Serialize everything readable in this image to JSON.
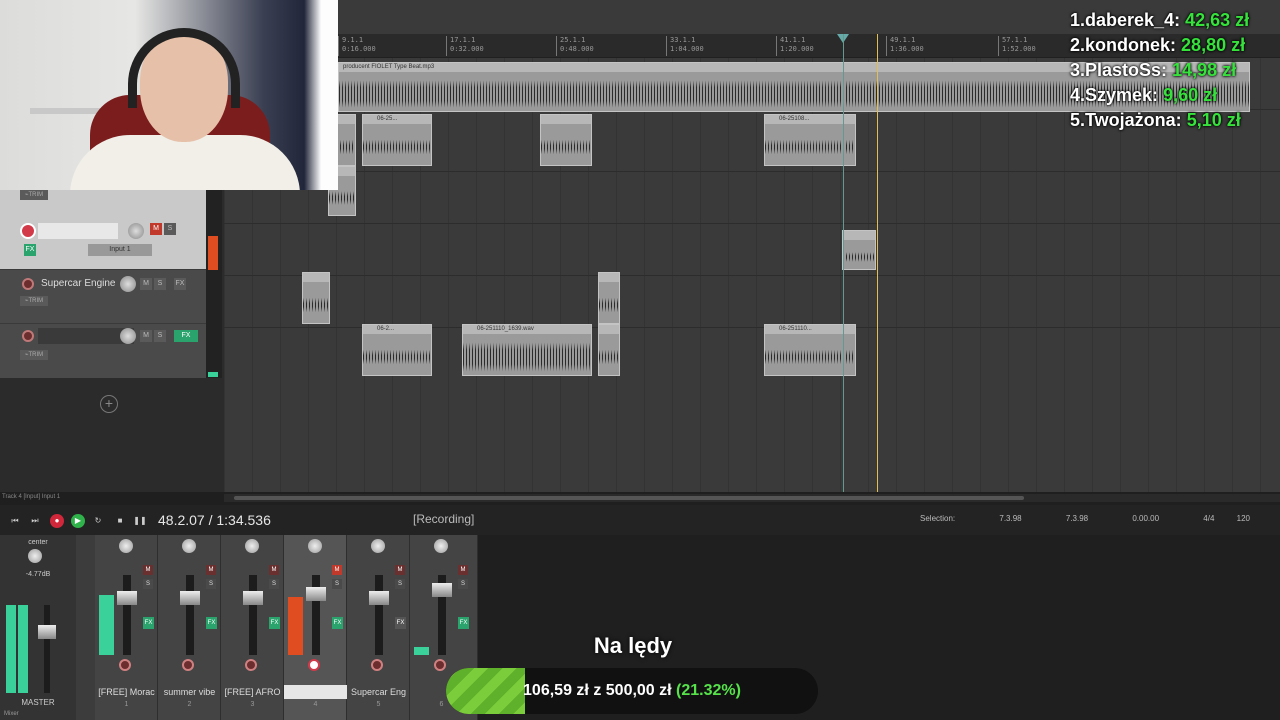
{
  "timeline": {
    "ticks": [
      {
        "label": "9.1.1",
        "sub": "0:16.000"
      },
      {
        "label": "17.1.1",
        "sub": "0:32.000"
      },
      {
        "label": "25.1.1",
        "sub": "0:48.000"
      },
      {
        "label": "33.1.1",
        "sub": "1:04.000"
      },
      {
        "label": "41.1.1",
        "sub": "1:20.000"
      },
      {
        "label": "49.1.1",
        "sub": "1:36.000"
      },
      {
        "label": "57.1.1",
        "sub": "1:52.000"
      }
    ]
  },
  "items": {
    "beat_name": "producent FIOLET Type Beat.mp3",
    "clip_a": "06-25...",
    "clip_b": "06-25108...",
    "clip_c": "06-2...",
    "clip_d": "06-251110_1639.wav",
    "clip_e": "06-251110..."
  },
  "tracks": [
    {
      "name": "",
      "input": "Input 1",
      "selected": true
    },
    {
      "name": "Supercar Engine F",
      "selected": false
    },
    {
      "name": "",
      "selected": false
    }
  ],
  "tcp_status": "Track 4 [Input] Input 1",
  "transport": {
    "position": "48.2.07 / 1:34.536",
    "state": "[Recording]",
    "selection_label": "Selection:",
    "sel_start": "7.3.98",
    "sel_end": "7.3.98",
    "sel_len": "0.00.00",
    "timesig": "4/4",
    "bpm": "120"
  },
  "mixer": {
    "master_label": "MASTER",
    "master_pan": "center",
    "master_db": "-4.77dB",
    "tab": "Mixer",
    "strips": [
      {
        "name": "[FREE] Morac",
        "num": "1"
      },
      {
        "name": "summer vibe",
        "num": "2"
      },
      {
        "name": "[FREE] AFRO",
        "num": "3"
      },
      {
        "name": "",
        "num": "4"
      },
      {
        "name": "Supercar Eng",
        "num": "5"
      },
      {
        "name": "",
        "num": "6"
      }
    ]
  },
  "leaderboard": [
    {
      "rank": "1.",
      "name": "daberek_4:",
      "amount": "42,63 zł"
    },
    {
      "rank": "2.",
      "name": "kondonek:",
      "amount": "28,80 zł"
    },
    {
      "rank": "3.",
      "name": "PlastoSs:",
      "amount": "14,98 zł"
    },
    {
      "rank": "4.",
      "name": "Szymek:",
      "amount": "9,60 zł"
    },
    {
      "rank": "5.",
      "name": "Twojażona:",
      "amount": "5,10 zł"
    }
  ],
  "goal": {
    "title": "Na lędy",
    "current": "106,59 zł",
    "sep": "z",
    "target": "500,00 zł",
    "percent_text": "(21.32%)",
    "progress": 0.2132
  }
}
